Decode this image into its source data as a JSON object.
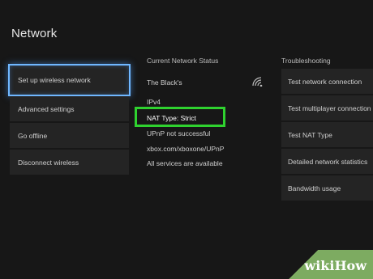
{
  "page": {
    "title": "Network"
  },
  "menu": {
    "items": [
      {
        "label": "Set up wireless network",
        "selected": true
      },
      {
        "label": "Advanced settings",
        "selected": false
      },
      {
        "label": "Go offline",
        "selected": false
      },
      {
        "label": "Disconnect wireless",
        "selected": false
      }
    ]
  },
  "status": {
    "header": "Current Network Status",
    "network_name": "The Black's",
    "ip_version": "IPv4",
    "nat_type": "NAT Type: Strict",
    "upnp": "UPnP not successful",
    "url": "xbox.com/xboxone/UPnP",
    "services": "All services are available",
    "icon": "wifi-signal-icon"
  },
  "troubleshooting": {
    "header": "Troubleshooting",
    "items": [
      "Test network connection",
      "Test multiplayer connection",
      "Test NAT Type",
      "Detailed network statistics",
      "Bandwidth usage"
    ]
  },
  "highlight": {
    "color": "#2fd22f"
  },
  "watermark": {
    "text": "wikiHow"
  }
}
